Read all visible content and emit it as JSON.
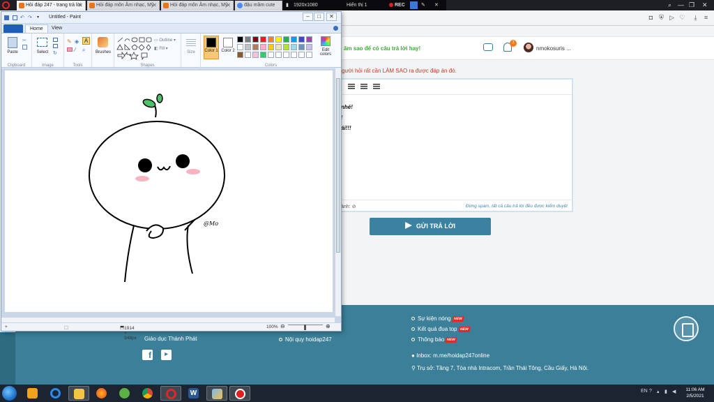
{
  "browser": {
    "tabs": [
      {
        "title": "Hỏi đáp 247 - trang trả lời",
        "active": true
      },
      {
        "title": "Hỏi đáp môn Âm nhạc, Mỹ",
        "active": false
      },
      {
        "title": "Hỏi đáp môn Âm nhạc, Mỹ",
        "active": false
      },
      {
        "title": "đậu mầm cute",
        "active": false
      }
    ],
    "recording": {
      "resolution": "1920x1080",
      "display": "Hiển thị 1",
      "rec_label": "REC"
    }
  },
  "site": {
    "header_promo": "ăm sao để có câu trả lời hay!",
    "notification_count": "7",
    "username": "nmokosuris ...",
    "hint_text": "gười hỏi rất cần LÀM SAO ra được đáp án đó.",
    "editor_lines": [
      "nhé!",
      "!",
      "ái!!!"
    ],
    "attach_label": "ảnh:",
    "spam_note": "Đừng spam, tất cả câu trả lời đều được kiểm duyệt",
    "submit_label": "GỬI TRẢ LỜI"
  },
  "footer": {
    "org_text": "Giáo dục Thành Phát",
    "rules_link": "Nội quy hoidap247",
    "links": [
      {
        "label": "Sự kiện nóng",
        "badge": "NEW"
      },
      {
        "label": "Kết quả đua top",
        "badge": "NEW"
      },
      {
        "label": "Thông báo",
        "badge": "NEW"
      }
    ],
    "inbox": "Inbox: m.me/hoidap247online",
    "address": "Trụ sở: Tầng 7, Tòa nhà Intracom, Trần Thái Tông, Cầu Giấy, Hà Nội."
  },
  "paint": {
    "title": "Untitled - Paint",
    "tabs": {
      "home": "Home",
      "view": "View"
    },
    "groups": {
      "clipboard": "Clipboard",
      "image": "Image",
      "tools": "Tools",
      "shapes": "Shapes",
      "colors": "Colors"
    },
    "buttons": {
      "paste": "Paste",
      "select": "Select",
      "brushes": "Brushes",
      "outline": "Outline",
      "fill": "Fill",
      "size": "Size",
      "color1": "Color 1",
      "color2": "Color 2",
      "edit_colors": "Edit colors"
    },
    "canvas_signature": "@Mo",
    "status": {
      "dimensions": "1914 × 948px",
      "zoom": "100%"
    },
    "palette_row1": [
      "#000000",
      "#7f7f7f",
      "#880015",
      "#ed1c24",
      "#ff7f27",
      "#fff200",
      "#22b14c",
      "#00a2e8",
      "#3f48cc",
      "#a349a4"
    ],
    "palette_row2": [
      "#ffffff",
      "#c3c3c3",
      "#b97a57",
      "#ffaec9",
      "#ffc90e",
      "#efe4b0",
      "#b5e61d",
      "#99d9ea",
      "#7092be",
      "#c8bfe7"
    ],
    "palette_row3": [
      "#8b5a2b",
      "#ffffff",
      "#f9c2d6",
      "#33cc66",
      "#ffffff",
      "#ffffff",
      "#ffffff",
      "#ffffff",
      "#ffffff",
      "#ffffff"
    ]
  },
  "taskbar": {
    "lang": "EN",
    "time": "11:06 AM",
    "date": "2/5/2021"
  }
}
